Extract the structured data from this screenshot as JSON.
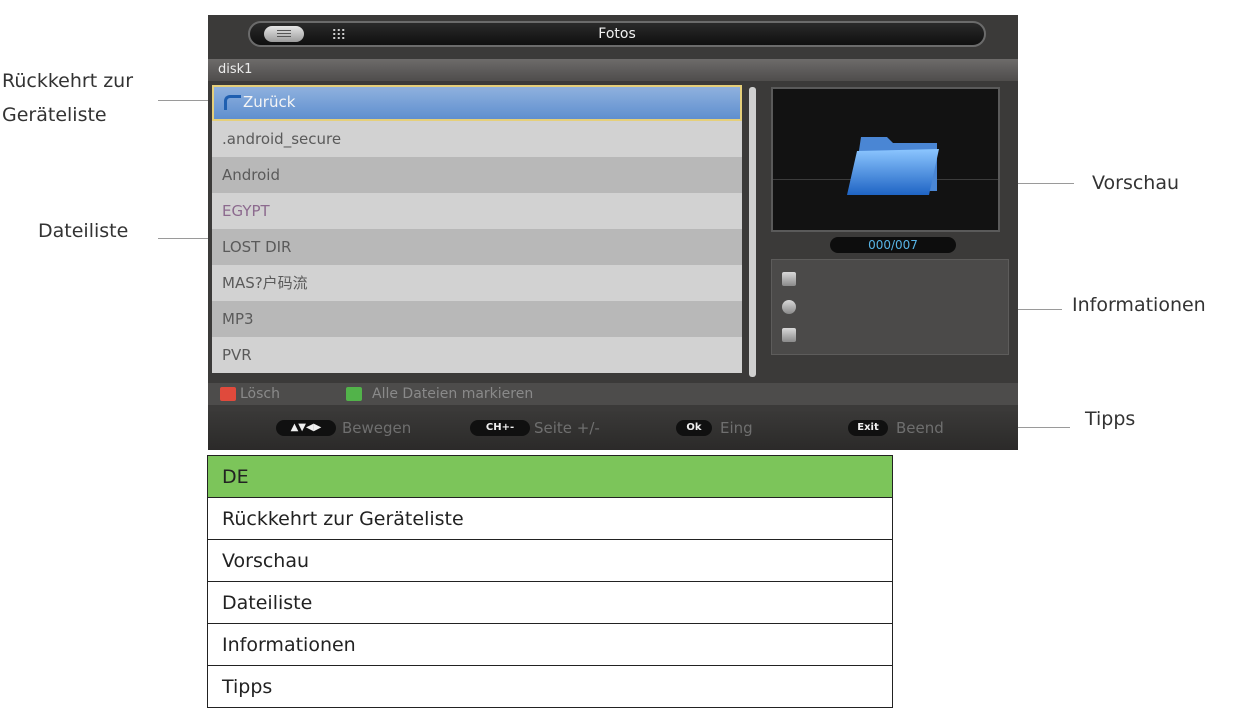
{
  "callouts": {
    "back_to_device_list_line1": "Rückkehrt zur",
    "back_to_device_list_line2": "Geräteliste",
    "file_list": "Dateiliste",
    "preview": "Vorschau",
    "information": "Informationen",
    "tips": "Tipps"
  },
  "screen": {
    "title": "Fotos",
    "path": "disk1",
    "files": [
      "Zurück",
      ".android_secure",
      "Android",
      "EGYPT",
      "LOST DIR",
      "MAS?户码流",
      "MP3",
      "PVR"
    ],
    "selected_index": 0,
    "counter": "000/007",
    "color_keys": {
      "red": "Lösch",
      "green": "Alle Dateien markieren"
    },
    "tips": [
      {
        "key": "▲▼◀▶",
        "label": "Bewegen"
      },
      {
        "key": "CH+-",
        "label": "Seite +/-"
      },
      {
        "key": "Ok",
        "label": "Eing"
      },
      {
        "key": "Exit",
        "label": "Beend"
      }
    ],
    "info_icons": [
      "resolution-icon",
      "disc-icon",
      "size-icon"
    ]
  },
  "table": {
    "header": "DE",
    "rows": [
      "Rückkehrt zur Geräteliste",
      "Vorschau",
      "Dateiliste",
      "Informationen",
      "Tipps"
    ]
  },
  "colors": {
    "table_header": "#7cc55a",
    "selected_row": "#6f9bd6",
    "red_key": "#e04a3c",
    "green_key": "#52b34a",
    "counter_text": "#57b4e6"
  }
}
